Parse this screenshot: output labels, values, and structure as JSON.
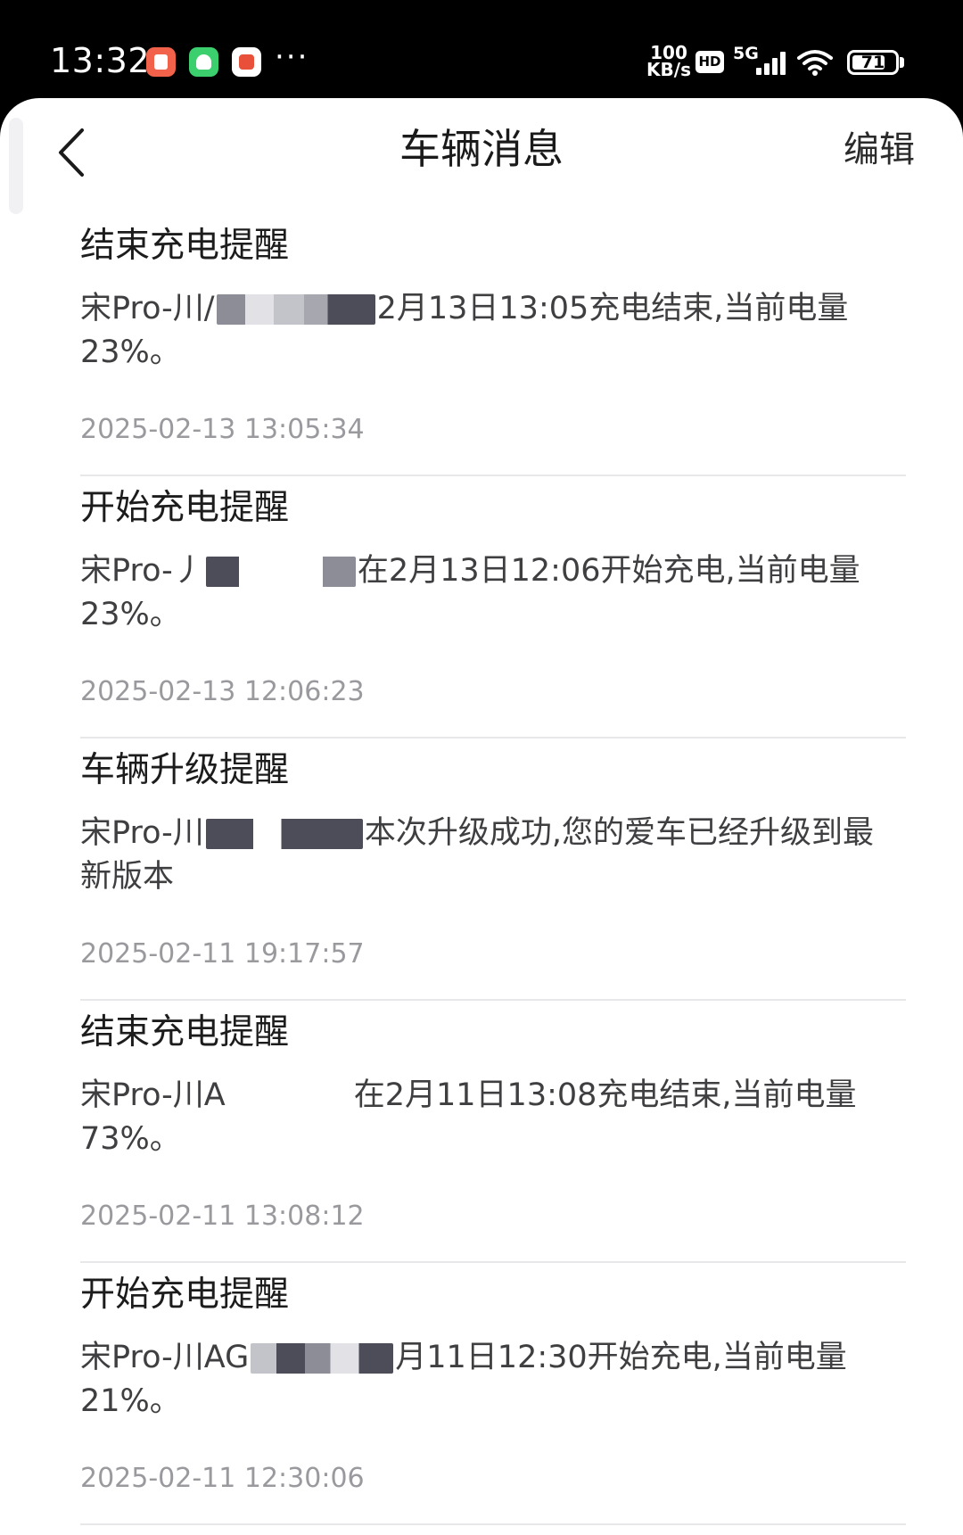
{
  "status_bar": {
    "time": "13:32",
    "more": "···",
    "net_speed_value": "100",
    "net_speed_unit": "KB/s",
    "hd": "HD",
    "network": "5G",
    "battery_level": "71"
  },
  "header": {
    "title": "车辆消息",
    "edit_label": "编辑"
  },
  "messages": [
    {
      "title": "结束充电提醒",
      "body_prefix": "宋Pro-川/",
      "body_suffix": "2月13日13:05充电结束,当前电量23%。",
      "time": "2025-02-13 13:05:34"
    },
    {
      "title": "开始充电提醒",
      "body_prefix": "宋Pro-丿",
      "body_suffix": "在2月13日12:06开始充电,当前电量23%。",
      "time": "2025-02-13 12:06:23"
    },
    {
      "title": "车辆升级提醒",
      "body_prefix": "宋Pro-川",
      "body_suffix": "本次升级成功,您的爱车已经升级到最新版本",
      "time": "2025-02-11 19:17:57"
    },
    {
      "title": "结束充电提醒",
      "body_prefix": "宋Pro-川A",
      "body_suffix": "在2月11日13:08充电结束,当前电量73%。",
      "time": "2025-02-11 13:08:12"
    },
    {
      "title": "开始充电提醒",
      "body_prefix": "宋Pro-川AG",
      "body_suffix": "月11日12:30开始充电,当前电量21%。",
      "time": "2025-02-11 12:30:06"
    }
  ]
}
